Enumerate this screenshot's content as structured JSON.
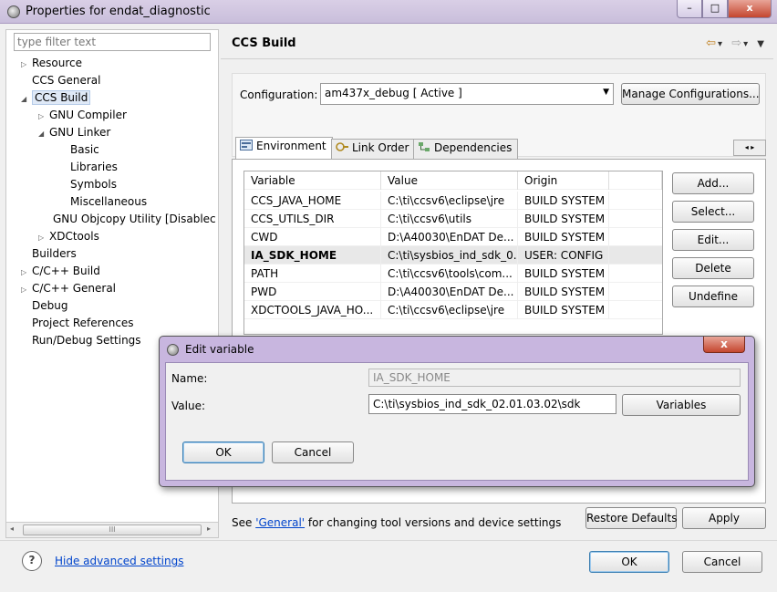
{
  "window": {
    "title": "Properties for endat_diagnostic",
    "minimize": "–",
    "maximize": "□",
    "close": "x"
  },
  "tree": {
    "filter_placeholder": "type filter text",
    "items": [
      {
        "label": "Resource",
        "twisty": "▷"
      },
      {
        "label": "CCS General",
        "twisty": ""
      },
      {
        "label": "CCS Build",
        "twisty": "◢"
      },
      {
        "label": "GNU Compiler",
        "twisty": "▷"
      },
      {
        "label": "GNU Linker",
        "twisty": "◢"
      },
      {
        "label": "Basic",
        "twisty": ""
      },
      {
        "label": "Libraries",
        "twisty": ""
      },
      {
        "label": "Symbols",
        "twisty": ""
      },
      {
        "label": "Miscellaneous",
        "twisty": ""
      },
      {
        "label": "GNU Objcopy Utility  [Disablec",
        "twisty": ""
      },
      {
        "label": "XDCtools",
        "twisty": "▷"
      },
      {
        "label": "Builders",
        "twisty": ""
      },
      {
        "label": "C/C++ Build",
        "twisty": "▷"
      },
      {
        "label": "C/C++ General",
        "twisty": "▷"
      },
      {
        "label": "Debug",
        "twisty": ""
      },
      {
        "label": "Project References",
        "twisty": ""
      },
      {
        "label": "Run/Debug Settings",
        "twisty": ""
      }
    ],
    "scroll_grip": "III"
  },
  "page": {
    "title": "CCS Build",
    "nav": {
      "back": "⇦",
      "back_menu": "▾",
      "forward": "⇨",
      "forward_menu": "▾",
      "menu": "▼"
    }
  },
  "configuration": {
    "label": "Configuration:",
    "value": "am437x_debug  [ Active ]",
    "arrow": "▼",
    "manage_button": "Manage Configurations..."
  },
  "tabs": [
    {
      "label": "Environment",
      "active": true
    },
    {
      "label": "Link Order",
      "active": false
    },
    {
      "label": "Dependencies",
      "active": false
    }
  ],
  "tab_scroll": "◂  ▸",
  "env_table": {
    "headers": [
      "Variable",
      "Value",
      "Origin"
    ],
    "rows": [
      {
        "variable": "CCS_JAVA_HOME",
        "value": "C:\\ti\\ccsv6\\eclipse\\jre",
        "origin": "BUILD SYSTEM",
        "highlight": false
      },
      {
        "variable": "CCS_UTILS_DIR",
        "value": "C:\\ti\\ccsv6\\utils",
        "origin": "BUILD SYSTEM",
        "highlight": false
      },
      {
        "variable": "CWD",
        "value": "D:\\A40030\\EnDAT De...",
        "origin": "BUILD SYSTEM",
        "highlight": false
      },
      {
        "variable": "IA_SDK_HOME",
        "value": "C:\\ti\\sysbios_ind_sdk_0...",
        "origin": "USER: CONFIG",
        "highlight": true
      },
      {
        "variable": "PATH",
        "value": "C:\\ti\\ccsv6\\tools\\com...",
        "origin": "BUILD SYSTEM",
        "highlight": false
      },
      {
        "variable": "PWD",
        "value": "D:\\A40030\\EnDAT De...",
        "origin": "BUILD SYSTEM",
        "highlight": false
      },
      {
        "variable": "XDCTOOLS_JAVA_HO...",
        "value": "C:\\ti\\ccsv6\\eclipse\\jre",
        "origin": "BUILD SYSTEM",
        "highlight": false
      }
    ],
    "buttons": {
      "add": "Add...",
      "select": "Select...",
      "edit": "Edit...",
      "delete": "Delete",
      "undefine": "Undefine"
    }
  },
  "footer": {
    "see_prefix": "See ",
    "see_link": "'General'",
    "see_suffix": " for changing tool versions and device settings",
    "restore_button": "Restore Defaults",
    "apply_button": "Apply"
  },
  "bottom": {
    "help": "?",
    "hide_advanced": "Hide advanced settings",
    "ok": "OK",
    "cancel": "Cancel"
  },
  "dialog": {
    "title": "Edit variable",
    "close": "x",
    "name_label": "Name:",
    "name_value": "IA_SDK_HOME",
    "value_label": "Value:",
    "value_value": "C:\\ti\\sysbios_ind_sdk_02.01.03.02\\sdk",
    "variables_button": "Variables",
    "ok": "OK",
    "cancel": "Cancel"
  },
  "colors": {
    "dialog_frame": "#c8b6df",
    "link": "#0044cc",
    "close_red": "#c4462e",
    "selection": "#dfe9f7"
  }
}
